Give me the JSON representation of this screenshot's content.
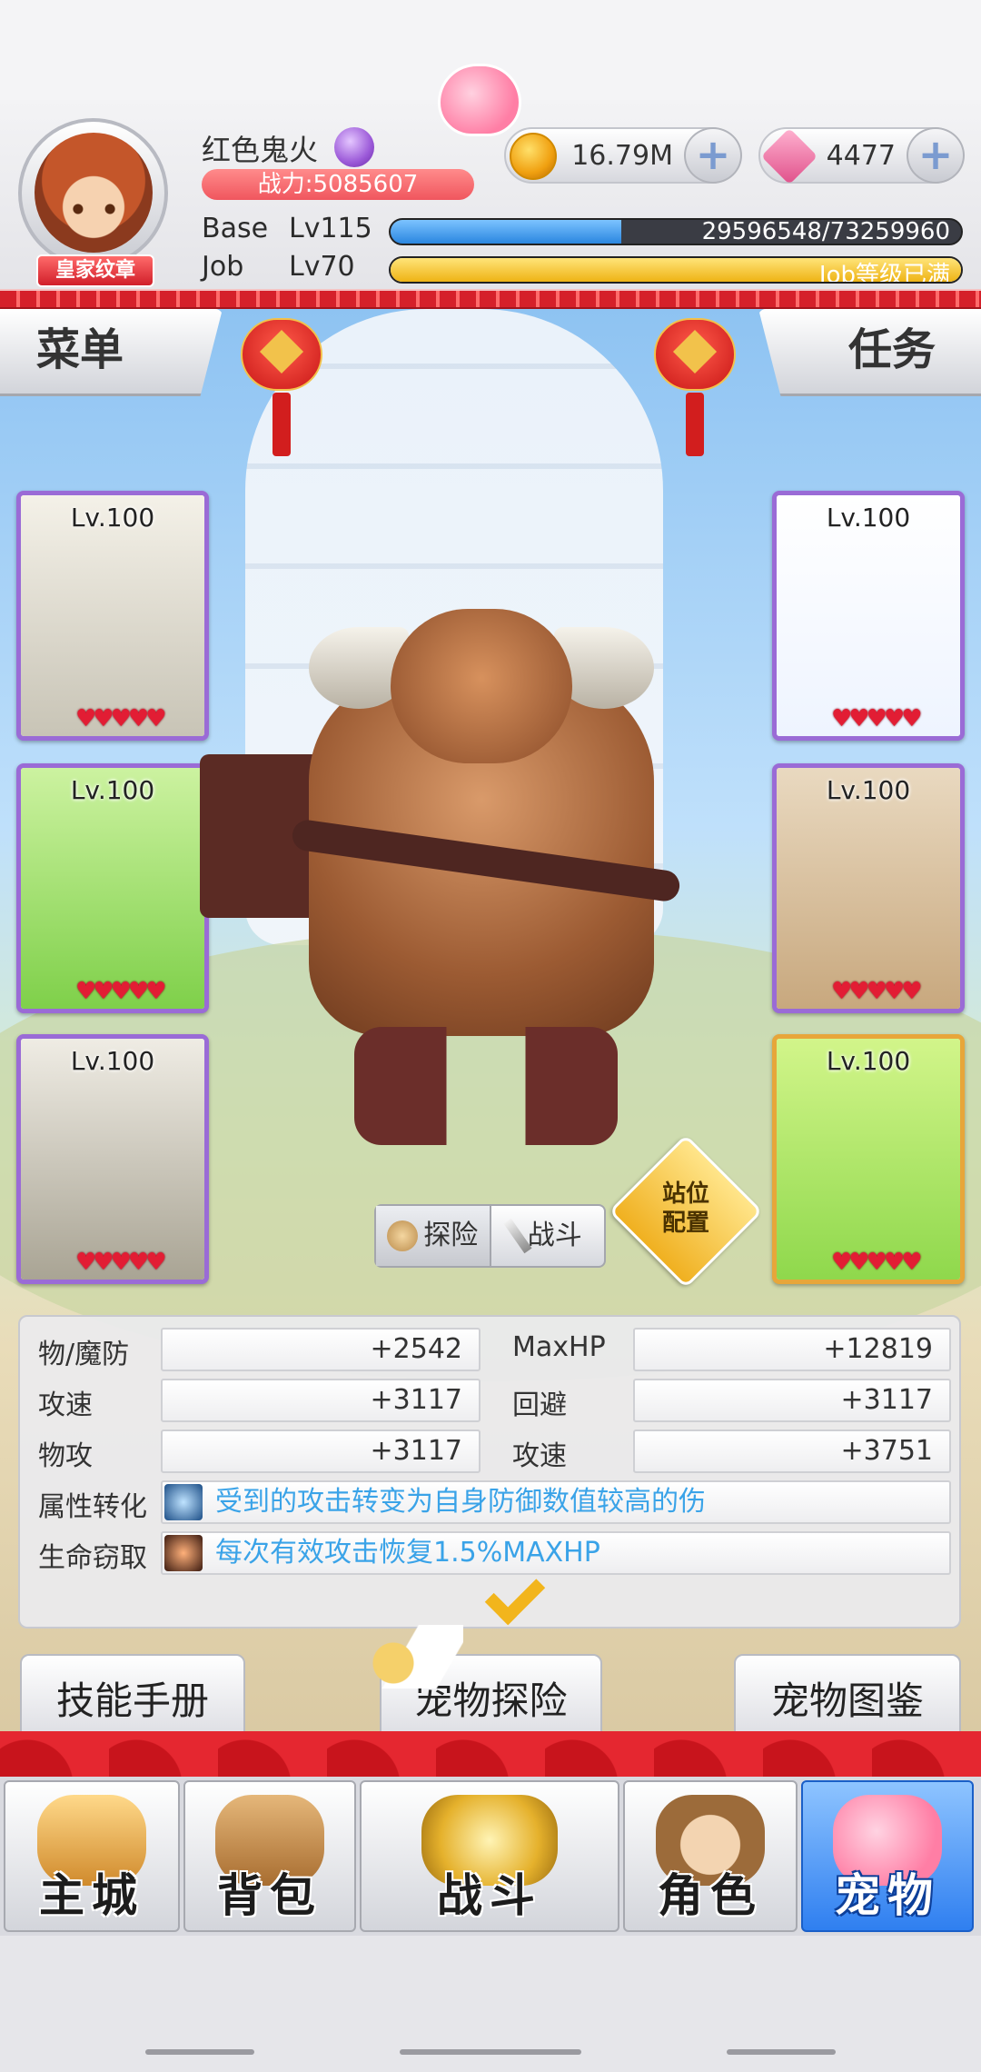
{
  "player": {
    "name": "红色鬼火",
    "badge": "皇家纹章",
    "power": "战力:5085607"
  },
  "currency": {
    "gold": "16.79M",
    "gems": "4477",
    "plus": "+"
  },
  "levels": {
    "base_label": "Base",
    "base_level": "Lv115",
    "base_exp": "29596548/73259960",
    "base_progress": 0.404,
    "job_label": "Job",
    "job_level": "Lv70",
    "job_exp": "Job等级已满",
    "job_progress": 1.0
  },
  "tabs": {
    "menu": "菜单",
    "task": "任务"
  },
  "cards": [
    {
      "level": "Lv.100",
      "hearts": "♥♥♥♥♥",
      "rarity": "purple"
    },
    {
      "level": "Lv.100",
      "hearts": "♥♥♥♥♥",
      "rarity": "purple"
    },
    {
      "level": "Lv.100",
      "hearts": "♥♥♥♥♥",
      "rarity": "purple"
    },
    {
      "level": "Lv.100",
      "hearts": "♥♥♥♥♥",
      "rarity": "purple"
    },
    {
      "level": "Lv.100",
      "hearts": "♥♥♥♥♥",
      "rarity": "purple"
    },
    {
      "level": "Lv.100",
      "hearts": "♥♥♥♥♥",
      "rarity": "gold"
    }
  ],
  "mode_toggle": {
    "explore": "探险",
    "battle": "战斗"
  },
  "formation": {
    "line1": "站位",
    "line2": "配置"
  },
  "stats": {
    "rows": [
      {
        "label": "物/魔防",
        "value": "+2542",
        "label2": "MaxHP",
        "value2": "+12819"
      },
      {
        "label": "攻速",
        "value": "+3117",
        "label2": "回避",
        "value2": "+3117"
      },
      {
        "label": "物攻",
        "value": "+3117",
        "label2": "攻速",
        "value2": "+3751"
      }
    ],
    "traits": [
      {
        "label": "属性转化",
        "text": "受到的攻击转变为自身防御数值较高的伤",
        "icon": "spirit-icon"
      },
      {
        "label": "生命窃取",
        "text": "每次有效攻击恢复1.5%MAXHP",
        "icon": "heart-drain-icon"
      }
    ]
  },
  "sub_buttons": {
    "skills": "技能手册",
    "pet_explore": "宠物探险",
    "pet_album": "宠物图鉴"
  },
  "nav": [
    {
      "label": "主城",
      "icon": "castle-icon",
      "active": false
    },
    {
      "label": "背包",
      "icon": "backpack-icon",
      "active": false
    },
    {
      "label": "战斗",
      "icon": "battle-emblem-icon",
      "active": false
    },
    {
      "label": "角色",
      "icon": "character-icon",
      "active": false
    },
    {
      "label": "宠物",
      "icon": "pet-icon",
      "active": true
    }
  ],
  "colors": {
    "accent_red": "#e52730",
    "exp_blue": "#3a9be8",
    "job_yellow": "#f3c22b",
    "trait_text": "#3aa3e8",
    "active_nav": "#2f7ff0"
  }
}
